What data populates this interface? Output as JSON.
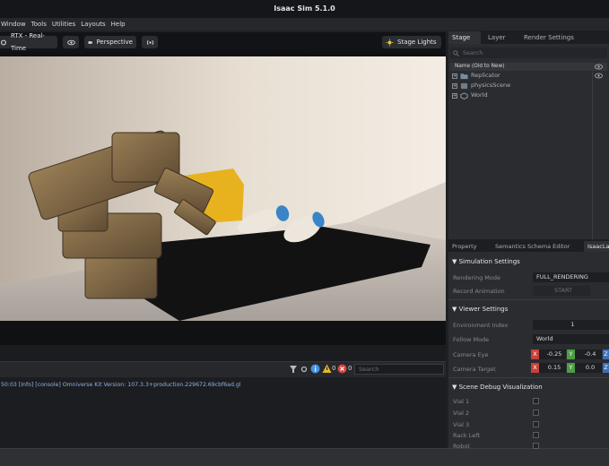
{
  "window": {
    "title": "Isaac Sim 5.1.0"
  },
  "menu": [
    "Window",
    "Tools",
    "Utilities",
    "Layouts",
    "Help"
  ],
  "viewport_toolbar": {
    "rtx_label": "RTX - Real-Time",
    "camera_label": "Perspective",
    "stage_lights_label": "Stage Lights"
  },
  "console": {
    "warning_count": "0",
    "error_count": "0",
    "search_placeholder": "Search",
    "log_line": "50:03  [Info] [console] Omniverse Kit Version: 107.3.3+production.229672.69cbf6ad.gl"
  },
  "stage": {
    "tabs": [
      "Stage",
      "Layer",
      "Render Settings"
    ],
    "active_tab": "Stage",
    "search_placeholder": "Search",
    "column_header": "Name (Old to New)",
    "items": [
      {
        "label": "Replicator",
        "icon": "folder-icon"
      },
      {
        "label": "physicsScene",
        "icon": "physics-icon"
      },
      {
        "label": "World",
        "icon": "xform-icon"
      }
    ]
  },
  "property": {
    "tabs": [
      "Property",
      "Semantics Schema Editor",
      "IsaacLa"
    ],
    "simulation": {
      "title": "Simulation Settings",
      "rendering_mode_label": "Rendering Mode",
      "rendering_mode_value": "FULL_RENDERING",
      "record_animation_label": "Record Animation",
      "start_label": "START"
    },
    "viewer": {
      "title": "Viewer Settings",
      "env_index_label": "Environment Index",
      "env_index_value": "1",
      "follow_mode_label": "Follow Mode",
      "follow_mode_value": "World",
      "camera_eye_label": "Camera Eye",
      "camera_eye": {
        "x": "-0.25",
        "y": "-0.4",
        "z": ""
      },
      "camera_target_label": "Camera Target",
      "camera_target": {
        "x": "0.15",
        "y": "0.0",
        "z": ""
      }
    },
    "scene_debug": {
      "title": "Scene Debug Visualization",
      "items": [
        "Vial 1",
        "Vial 2",
        "Vial 3",
        "Rack Left",
        "Robot"
      ]
    }
  },
  "colors": {
    "x_axis": "#c8413b",
    "y_axis": "#4d9d45",
    "z_axis": "#3b6fb8",
    "info": "#4a8fe0",
    "warning": "#e3b72c",
    "error": "#d8453d"
  }
}
